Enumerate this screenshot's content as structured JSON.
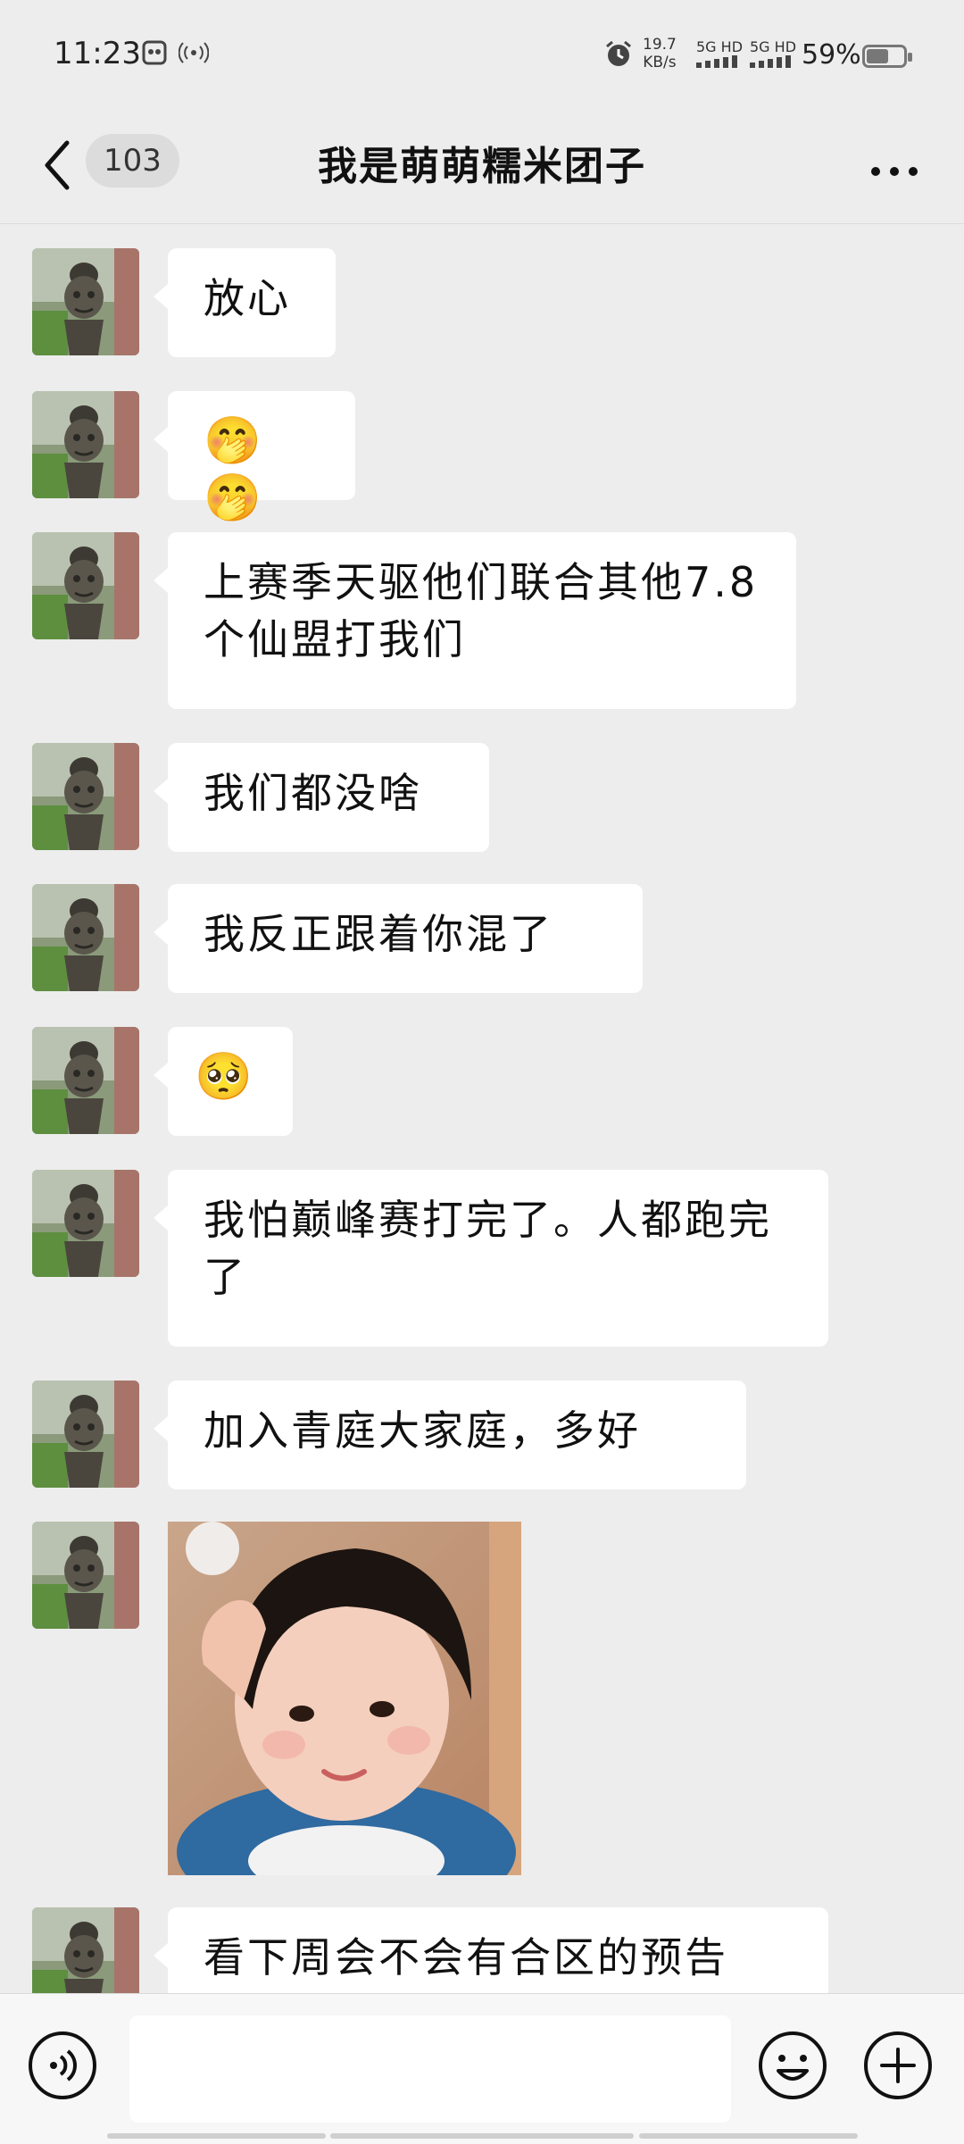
{
  "status_bar": {
    "time": "11:23",
    "net_speed": "19.7",
    "net_speed_unit": "KB/s",
    "signal1": "5G HD",
    "signal2": "5G HD",
    "battery": "59%"
  },
  "header": {
    "unread_count": "103",
    "title": "我是萌萌糯米团子"
  },
  "messages": [
    {
      "type": "text",
      "text": "放心"
    },
    {
      "type": "text",
      "text": "🤭🤭"
    },
    {
      "type": "text",
      "text": "上赛季天驱他们联合其他7.8个仙盟打我们"
    },
    {
      "type": "text",
      "text": "我们都没啥"
    },
    {
      "type": "text",
      "text": "我反正跟着你混了"
    },
    {
      "type": "text",
      "text": "🥺"
    },
    {
      "type": "text",
      "text": "我怕巅峰赛打完了。人都跑完了"
    },
    {
      "type": "text",
      "text": "加入青庭大家庭，多好"
    },
    {
      "type": "image"
    },
    {
      "type": "text",
      "text": "看下周会不会有合区的预告"
    }
  ],
  "icons": {
    "back": "chevron-left-icon",
    "more": "more-dots-icon",
    "voice": "voice-icon",
    "emoji": "emoji-icon",
    "plus": "plus-icon"
  }
}
